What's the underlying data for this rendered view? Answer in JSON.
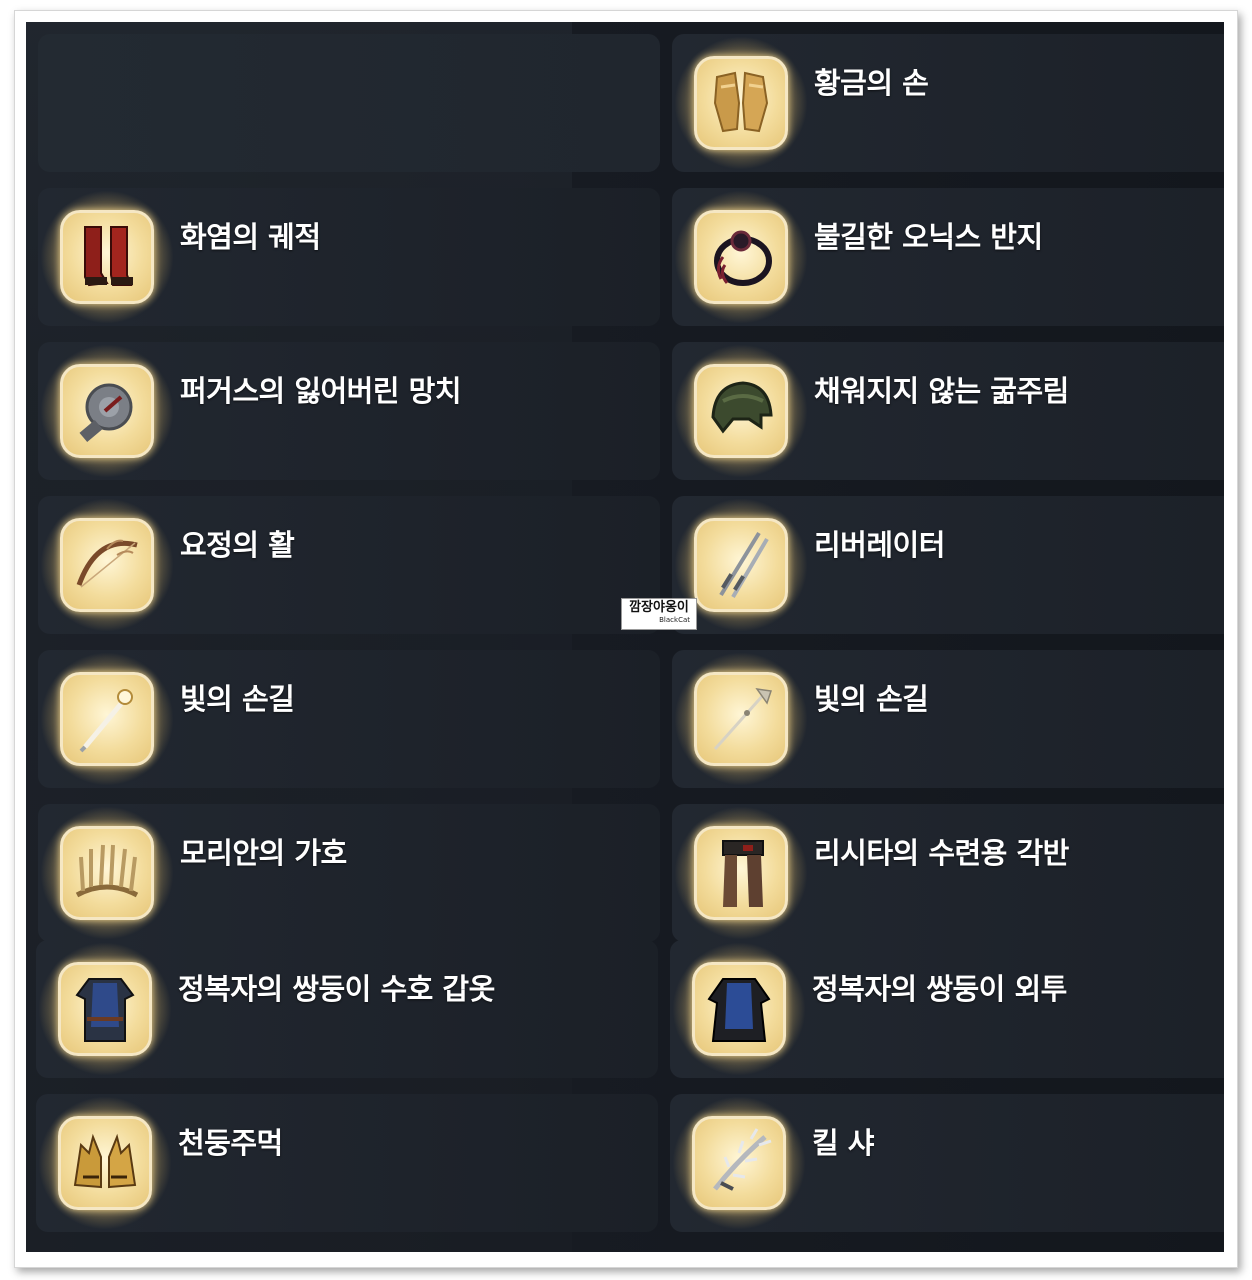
{
  "watermark": {
    "main": "깜장야옹이",
    "sub": "BlackCat"
  },
  "items": [
    {
      "name": "",
      "icon": "empty-slot"
    },
    {
      "name": "황금의 손",
      "icon": "golden-gloves-icon"
    },
    {
      "name": "화염의 궤적",
      "icon": "flame-boots-icon"
    },
    {
      "name": "불길한 오닉스 반지",
      "icon": "onyx-ring-icon"
    },
    {
      "name": "퍼거스의 잃어버린 망치",
      "icon": "hammer-icon"
    },
    {
      "name": "채워지지 않는 굶주림",
      "icon": "helmet-icon"
    },
    {
      "name": "요정의 활",
      "icon": "bow-icon"
    },
    {
      "name": "리버레이터",
      "icon": "twin-blades-icon"
    },
    {
      "name": "빛의 손길",
      "icon": "wand-icon"
    },
    {
      "name": "빛의 손길",
      "icon": "staff-icon"
    },
    {
      "name": "모리안의 가호",
      "icon": "feather-crown-icon"
    },
    {
      "name": "리시타의 수련용 각반",
      "icon": "leggings-icon"
    },
    {
      "name": "정복자의 쌍둥이 수호 갑옷",
      "icon": "armor-icon"
    },
    {
      "name": "정복자의 쌍둥이 외투",
      "icon": "coat-icon"
    },
    {
      "name": "천둥주먹",
      "icon": "gauntlets-icon"
    },
    {
      "name": "킬 샤",
      "icon": "spiked-weapon-icon"
    }
  ]
}
